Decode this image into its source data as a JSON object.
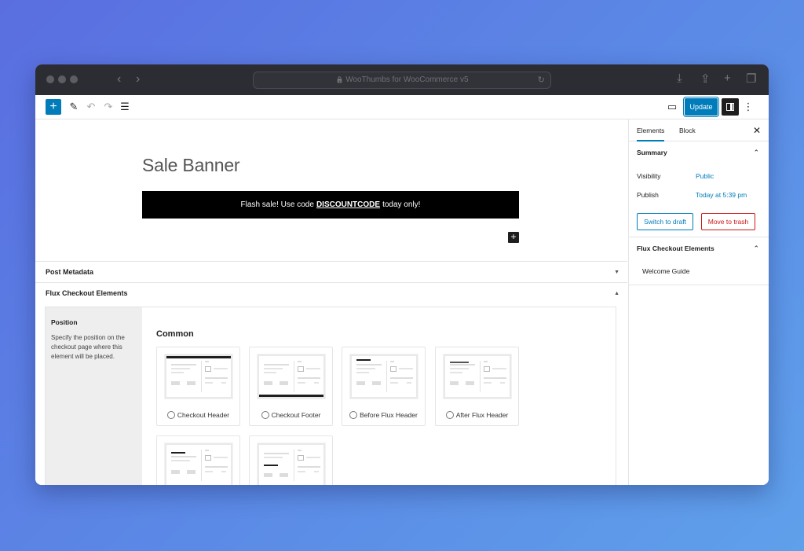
{
  "browser": {
    "url_text": "WooThumbs for WooCommerce v5",
    "back_icon": "‹",
    "forward_icon": "›",
    "lock_icon": "🔒",
    "reload_icon": "↻",
    "download_icon": "⤓",
    "share_icon": "⇪",
    "new_tab_icon": "+",
    "tabs_icon": "❐"
  },
  "toolbar": {
    "add_icon": "+",
    "pen_icon": "✎",
    "undo_icon": "↶",
    "redo_icon": "↷",
    "list_icon": "☰",
    "preview_icon": "▭",
    "update_label": "Update",
    "more_icon": "⋮"
  },
  "canvas": {
    "title": "Sale Banner",
    "banner_prefix": "Flash sale! Use code",
    "banner_code": "DISCOUNTCODE",
    "banner_suffix": "today only!",
    "add_block_icon": "+"
  },
  "panels": {
    "post_metadata": "Post Metadata",
    "post_metadata_arrow": "▼",
    "flux_checkout": "Flux Checkout Elements",
    "flux_checkout_arrow": "▲"
  },
  "position": {
    "title": "Position",
    "description": "Specify the position on the checkout page where this element will be placed."
  },
  "common": {
    "heading": "Common",
    "options": [
      {
        "label": "Checkout Header"
      },
      {
        "label": "Checkout Footer"
      },
      {
        "label": "Before Flux Header"
      },
      {
        "label": "After Flux Header"
      }
    ]
  },
  "sidebar": {
    "tab_elements": "Elements",
    "tab_block": "Block",
    "close_icon": "✕",
    "summary_title": "Summary",
    "summary_chevron": "⌃",
    "visibility_label": "Visibility",
    "visibility_value": "Public",
    "publish_label": "Publish",
    "publish_value": "Today at 5:39 pm",
    "switch_draft": "Switch to draft",
    "move_trash": "Move to trash",
    "flux_title": "Flux Checkout Elements",
    "flux_chevron": "⌃",
    "welcome_guide": "Welcome Guide"
  },
  "colors": {
    "accent": "#007cba",
    "danger": "#cc1818"
  }
}
